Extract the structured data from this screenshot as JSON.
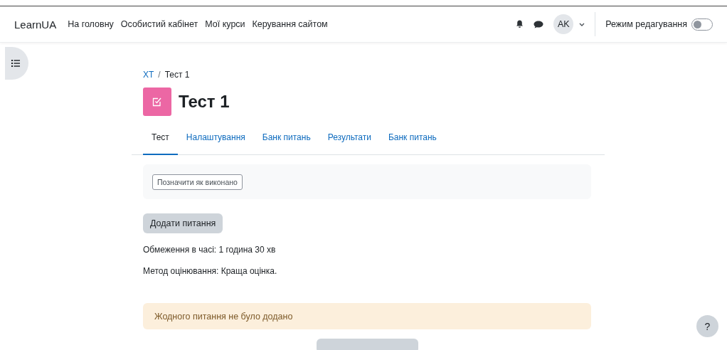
{
  "navbar": {
    "brand": "LearnUA",
    "links": [
      {
        "label": "На головну"
      },
      {
        "label": "Особистий кабінет"
      },
      {
        "label": "Мої курси"
      },
      {
        "label": "Керування сайтом"
      }
    ],
    "user_initials": "AK",
    "edit_mode": {
      "label": "Режим редагування",
      "on": false
    }
  },
  "breadcrumb": [
    {
      "label": "ХТ",
      "kind": "link"
    },
    {
      "label": "/",
      "kind": "separator"
    },
    {
      "label": "Тест 1",
      "kind": "current"
    }
  ],
  "page_title": "Тест 1",
  "tabs": [
    {
      "label": "Тест",
      "selected": true
    },
    {
      "label": "Налаштування",
      "selected": false
    },
    {
      "label": "Банк питань",
      "selected": false
    },
    {
      "label": "Результати",
      "selected": false
    },
    {
      "label": "Банк питань",
      "selected": false
    }
  ],
  "completion_button": "Позначити як виконано",
  "add_question_button": "Додати питання",
  "info": [
    "Обмеження в часі: 1 година 30 хв",
    "Метод оцінювання: Краща оцінка."
  ],
  "alert": "Жодного питання не було додано",
  "help_button": "?"
}
